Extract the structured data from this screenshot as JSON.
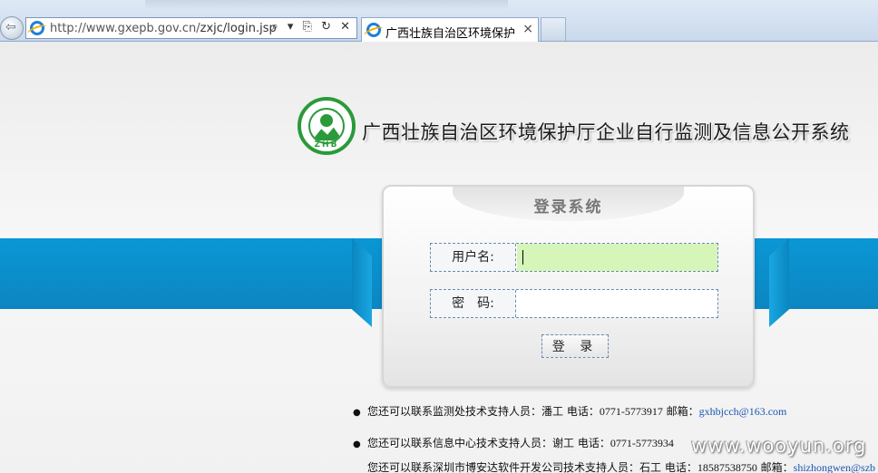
{
  "browser": {
    "url_host": "http://www.gxepb.gov.cn/",
    "url_path": "zxjc/login.jsp",
    "tab_title": "广西壮族自治区环境保护厅...",
    "tab_close": "×",
    "addr_controls": "⌕ ▾ ⎘ ↻ ✕",
    "back_glyph": "⇦"
  },
  "header": {
    "logo_text": "ZHB",
    "title": "广西壮族自治区环境保护厅企业自行监测及信息公开系统"
  },
  "login": {
    "title": "登录系统",
    "username_label": "用户名:",
    "password_label": "密　码:",
    "username_value": "",
    "password_value": "",
    "submit_label": "登 录"
  },
  "contacts": [
    {
      "bullet": "●",
      "text": "您还可以联系监测处技术支持人员：潘工 电话：",
      "phone": "0771-5773917",
      "mail_label": " 邮箱：",
      "email": "gxhbjcch@163.com"
    },
    {
      "bullet": "●",
      "text": "您还可以联系信息中心技术支持人员：谢工 电话：",
      "phone": "0771-5773934"
    },
    {
      "bullet": "",
      "text": "您还可以联系深圳市博安达软件开发公司技术支持人员：石工 电话：",
      "phone": "18587538750",
      "mail_label": " 邮箱：",
      "email": "shizhongwen@szb"
    }
  ],
  "watermark": "www.wooyun.org",
  "colors": {
    "band": "#0a97d4",
    "logo_green": "#2a9a3a",
    "link": "#1a56b0",
    "username_bg": "#d6f5b8"
  }
}
